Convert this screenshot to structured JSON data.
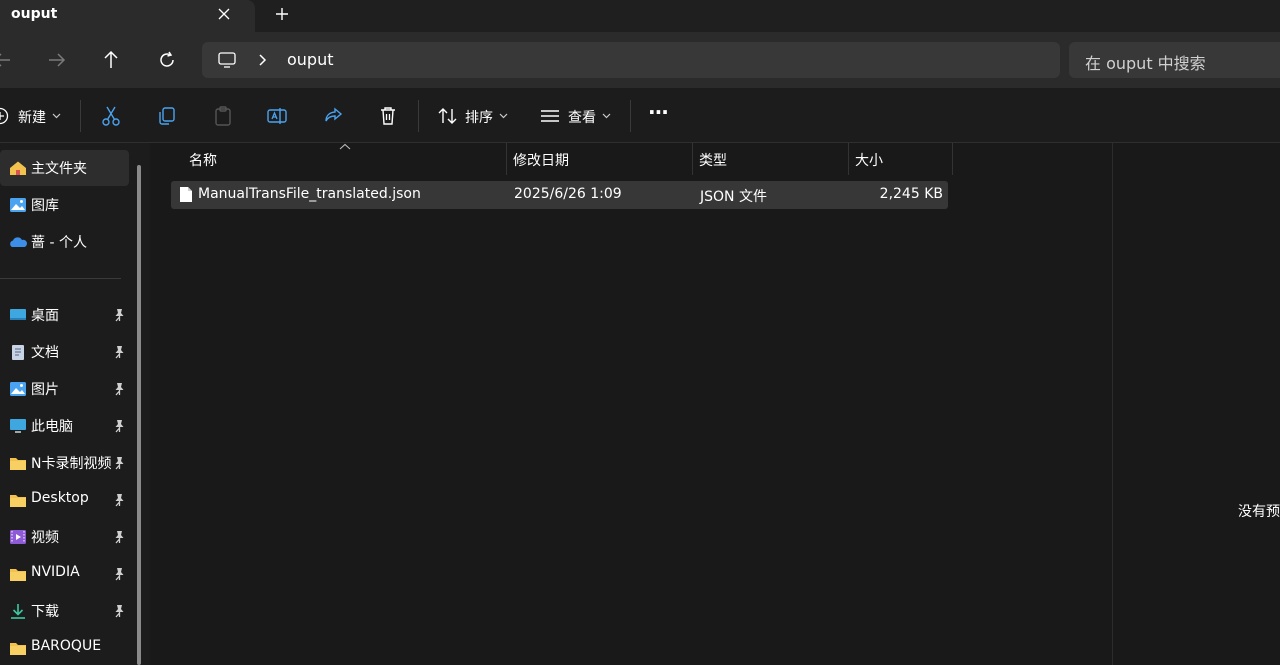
{
  "tab": {
    "title": "ouput",
    "close_icon": "close-icon",
    "new_tab_icon": "plus-icon"
  },
  "nav": {
    "back_icon": "arrow-left-icon",
    "forward_icon": "arrow-right-icon",
    "up_icon": "arrow-up-icon",
    "refresh_icon": "refresh-icon"
  },
  "address": {
    "segments": [
      "ouput"
    ]
  },
  "search": {
    "placeholder": "在 ouput 中搜索"
  },
  "toolbar": {
    "new_label": "新建",
    "sort_label": "排序",
    "view_label": "查看",
    "more_label": "···"
  },
  "sidebar": {
    "items": [
      {
        "label": "主文件夹",
        "icon": "home-icon",
        "selected": true
      },
      {
        "label": "图库",
        "icon": "gallery-icon"
      },
      {
        "label": "蔷 - 个人",
        "icon": "onedrive-icon"
      },
      {
        "label": "桌面",
        "icon": "desktop-icon",
        "pinned": true
      },
      {
        "label": "文档",
        "icon": "document-icon",
        "pinned": true
      },
      {
        "label": "图片",
        "icon": "pictures-icon",
        "pinned": true
      },
      {
        "label": "此电脑",
        "icon": "computer-icon",
        "pinned": true
      },
      {
        "label": "N卡录制视频",
        "icon": "folder-icon",
        "pinned": true
      },
      {
        "label": "Desktop",
        "icon": "folder-icon",
        "pinned": true
      },
      {
        "label": "视频",
        "icon": "videos-icon",
        "pinned": true
      },
      {
        "label": "NVIDIA",
        "icon": "folder-icon",
        "pinned": true
      },
      {
        "label": "下载",
        "icon": "download-icon",
        "pinned": true
      },
      {
        "label": "BAROQUE",
        "icon": "folder-icon"
      }
    ]
  },
  "table": {
    "columns": [
      "名称",
      "修改日期",
      "类型",
      "大小"
    ],
    "rows": [
      {
        "name": "ManualTransFile_translated.json",
        "modified": "2025/6/26 1:09",
        "type": "JSON 文件",
        "size": "2,245 KB"
      }
    ]
  },
  "preview": {
    "text": "没有预"
  },
  "colors": {
    "folder": "#f2c14e",
    "accent": "#4aa3f0",
    "background": "#191919"
  }
}
